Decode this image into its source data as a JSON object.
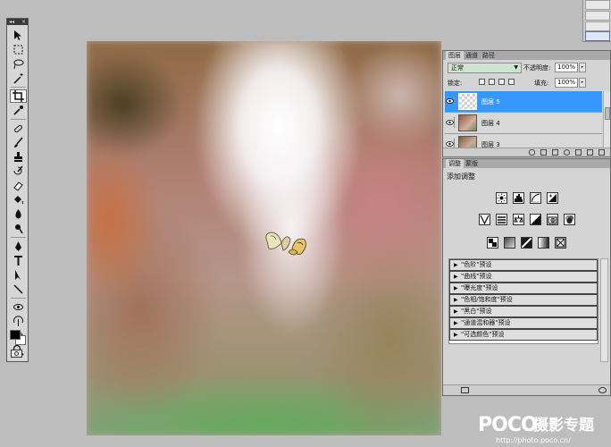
{
  "tools_panel": {
    "header_left": "◂◂",
    "header_right": "×",
    "tools": [
      "move-tool",
      "marquee-tool",
      "lasso-tool",
      "magic-wand-tool",
      "crop-tool",
      "eyedropper-tool",
      "healing-brush-tool",
      "brush-tool",
      "clone-stamp-tool",
      "history-brush-tool",
      "eraser-tool",
      "paint-bucket-tool",
      "blur-tool",
      "dodge-tool",
      "pen-tool",
      "type-tool",
      "path-selection-tool",
      "line-tool",
      "3d-rotate-tool",
      "3d-orbit-tool",
      "hand-tool",
      "zoom-tool"
    ],
    "active_tool": "crop-tool",
    "foreground_color": "#000000",
    "background_color": "#ffffff"
  },
  "layers_panel": {
    "tabs": [
      "图层",
      "通道",
      "路径"
    ],
    "blend_mode": "正常",
    "opacity_label": "不透明度:",
    "opacity_value": "100%",
    "lock_label": "锁定:",
    "fill_label": "填充:",
    "fill_value": "100%",
    "layers": [
      {
        "name": "图层 5",
        "selected": true
      },
      {
        "name": "图层 4",
        "selected": false
      },
      {
        "name": "图层 3",
        "selected": false
      }
    ]
  },
  "adjustments_panel": {
    "tabs": [
      "调整",
      "蒙版"
    ],
    "title": "添加调整",
    "presets": [
      "\"色阶\"预设",
      "\"曲线\"预设",
      "\"曝光度\"预设",
      "\"色相/饱和度\"预设",
      "\"黑白\"预设",
      "\"通道混和器\"预设",
      "\"可选颜色\"预设"
    ]
  },
  "watermark": {
    "logo": "POCO",
    "text": "摄影专题",
    "url": "http://photo.poco.cn/"
  }
}
